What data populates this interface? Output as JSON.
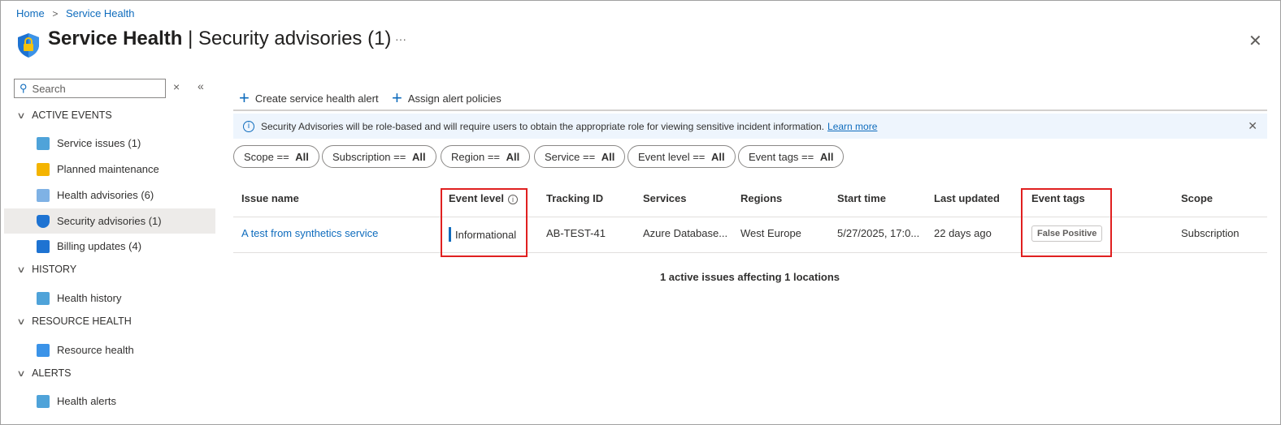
{
  "breadcrumb": [
    "Home",
    "Service Health"
  ],
  "title": {
    "main": "Service Health",
    "separator": " | ",
    "sub": "Security advisories (1)",
    "more": "···"
  },
  "sidebar": {
    "search_placeholder": "Search",
    "sections": [
      {
        "label": "ACTIVE EVENTS",
        "items": [
          {
            "label": "Service issues (1)",
            "icon": "service-issues-icon"
          },
          {
            "label": "Planned maintenance",
            "icon": "megaphone-icon"
          },
          {
            "label": "Health advisories (6)",
            "icon": "calendar-icon"
          },
          {
            "label": "Security advisories (1)",
            "icon": "shield-lock-icon",
            "selected": true
          },
          {
            "label": "Billing updates (4)",
            "icon": "billing-icon"
          }
        ]
      },
      {
        "label": "HISTORY",
        "items": [
          {
            "label": "Health history",
            "icon": "history-icon"
          }
        ]
      },
      {
        "label": "RESOURCE HEALTH",
        "items": [
          {
            "label": "Resource health",
            "icon": "heart-pulse-icon"
          }
        ]
      },
      {
        "label": "ALERTS",
        "items": [
          {
            "label": "Health alerts",
            "icon": "alert-icon"
          }
        ]
      }
    ]
  },
  "toolbar": {
    "create": "Create service health alert",
    "assign": "Assign alert policies"
  },
  "banner": {
    "text": "Security Advisories will be role-based and will require users to obtain the appropriate role for viewing sensitive incident information.",
    "link": "Learn more"
  },
  "filters": [
    {
      "name": "Scope",
      "value": "All"
    },
    {
      "name": "Subscription",
      "value": "All"
    },
    {
      "name": "Region",
      "value": "All"
    },
    {
      "name": "Service",
      "value": "All"
    },
    {
      "name": "Event level",
      "value": "All"
    },
    {
      "name": "Event tags",
      "value": "All"
    }
  ],
  "filter_op": " == ",
  "table": {
    "headers": [
      "Issue name",
      "Event level",
      "Tracking ID",
      "Services",
      "Regions",
      "Start time",
      "Last updated",
      "Event tags",
      "Scope"
    ],
    "rows": [
      {
        "issue": "A test from synthetics service",
        "level": "Informational",
        "tracking": "AB-TEST-41",
        "services": "Azure Database...",
        "regions": "West Europe",
        "start": "5/27/2025, 17:0...",
        "updated": "22 days ago",
        "tag": "False Positive",
        "scope": "Subscription"
      }
    ]
  },
  "summary": "1 active issues affecting 1 locations",
  "colors": {
    "accent": "#0f6cbd",
    "highlight": "#e02020",
    "banner": "#eef5fd"
  }
}
